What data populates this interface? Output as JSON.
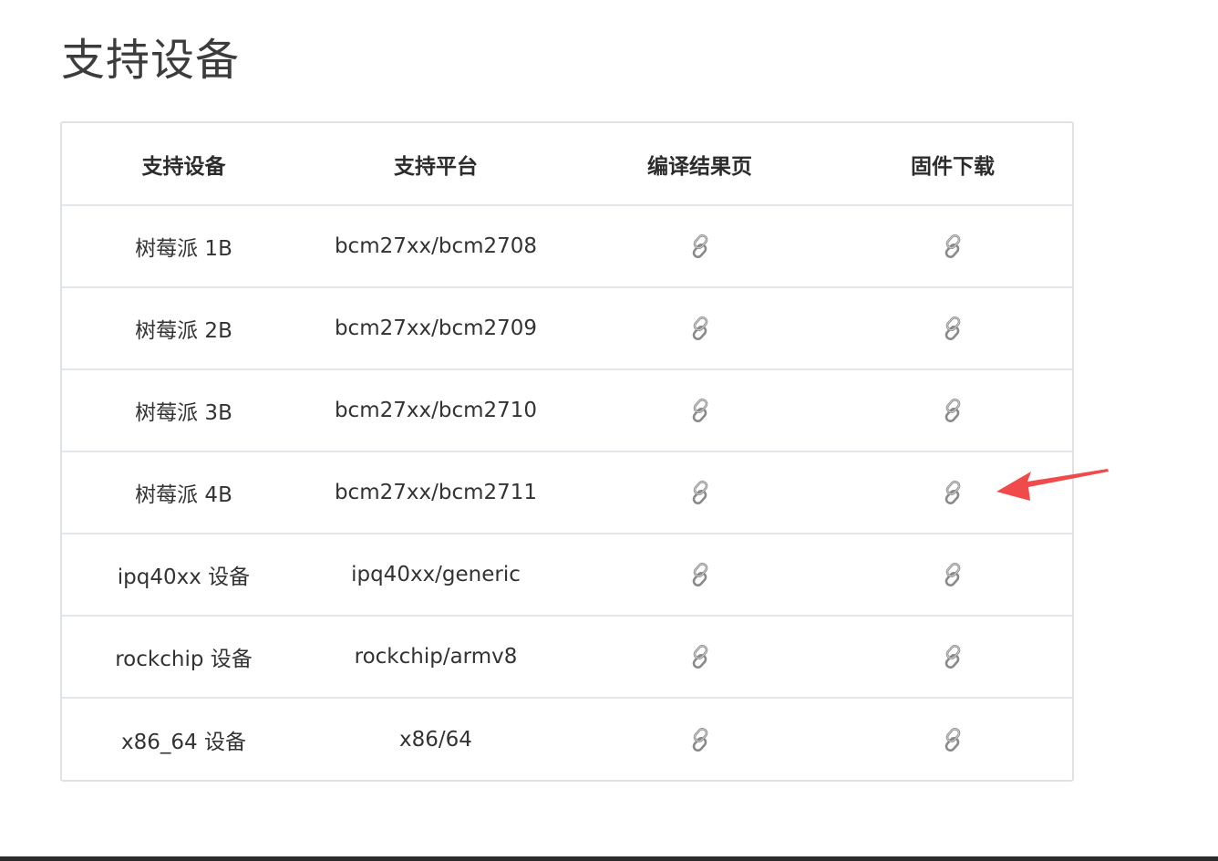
{
  "page": {
    "title": "支持设备"
  },
  "table": {
    "headers": [
      "支持设备",
      "支持平台",
      "编译结果页",
      "固件下载"
    ],
    "rows": [
      {
        "device": "树莓派 1B",
        "platform": "bcm27xx/bcm2708",
        "build_icon": "link-icon",
        "download_icon": "link-icon"
      },
      {
        "device": "树莓派 2B",
        "platform": "bcm27xx/bcm2709",
        "build_icon": "link-icon",
        "download_icon": "link-icon"
      },
      {
        "device": "树莓派 3B",
        "platform": "bcm27xx/bcm2710",
        "build_icon": "link-icon",
        "download_icon": "link-icon"
      },
      {
        "device": "树莓派 4B",
        "platform": "bcm27xx/bcm2711",
        "build_icon": "link-icon",
        "download_icon": "link-icon"
      },
      {
        "device": "ipq40xx 设备",
        "platform": "ipq40xx/generic",
        "build_icon": "link-icon",
        "download_icon": "link-icon"
      },
      {
        "device": "rockchip 设备",
        "platform": "rockchip/armv8",
        "build_icon": "link-icon",
        "download_icon": "link-icon"
      },
      {
        "device": "x86_64 设备",
        "platform": "x86/64",
        "build_icon": "link-icon",
        "download_icon": "link-icon"
      }
    ]
  },
  "annotation": {
    "icon": "arrow-annotation",
    "color": "#f04a4a"
  },
  "colors": {
    "border": "#dfe2e5",
    "text": "#333333",
    "icon": "#8a8a8a"
  }
}
